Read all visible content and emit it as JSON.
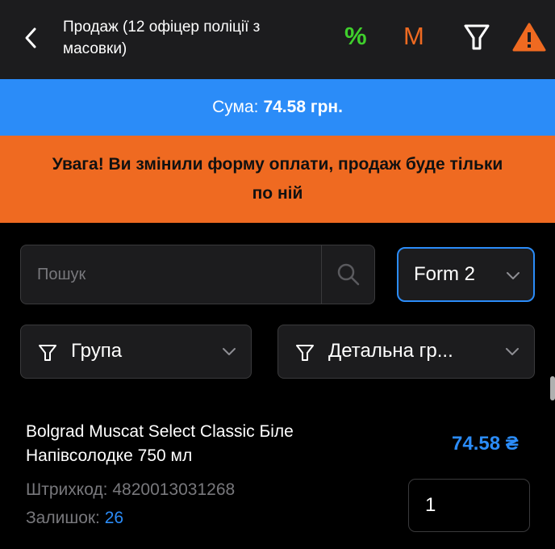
{
  "header": {
    "title": "Продаж (12 офіцер поліції з масовки)",
    "percent_label": "%",
    "m_label": "M",
    "icons": [
      "back-icon",
      "filter-icon",
      "warning-icon"
    ],
    "accent_green": "#3fcf2c",
    "accent_orange": "#ef6a21"
  },
  "sum_bar": {
    "label": "Сума:",
    "value": "74.58 грн.",
    "color": "#2b8cf8"
  },
  "warning": {
    "text": "Увага! Ви змінили форму оплати, продаж буде тільки по ній",
    "color": "#ef6a21"
  },
  "search": {
    "placeholder": "Пошук",
    "value": ""
  },
  "form_select": {
    "selected": "Form 2"
  },
  "filters": {
    "group_label": "Група",
    "detail_label": "Детальна гр..."
  },
  "product": {
    "name": "Bolgrad Muscat Select Classic Біле Напівсолодке 750 мл",
    "price": "74.58 ₴",
    "barcode_label": "Штрихкод:",
    "barcode": "4820013031268",
    "stock_label": "Залишок:",
    "stock": "26",
    "quantity": "1"
  }
}
